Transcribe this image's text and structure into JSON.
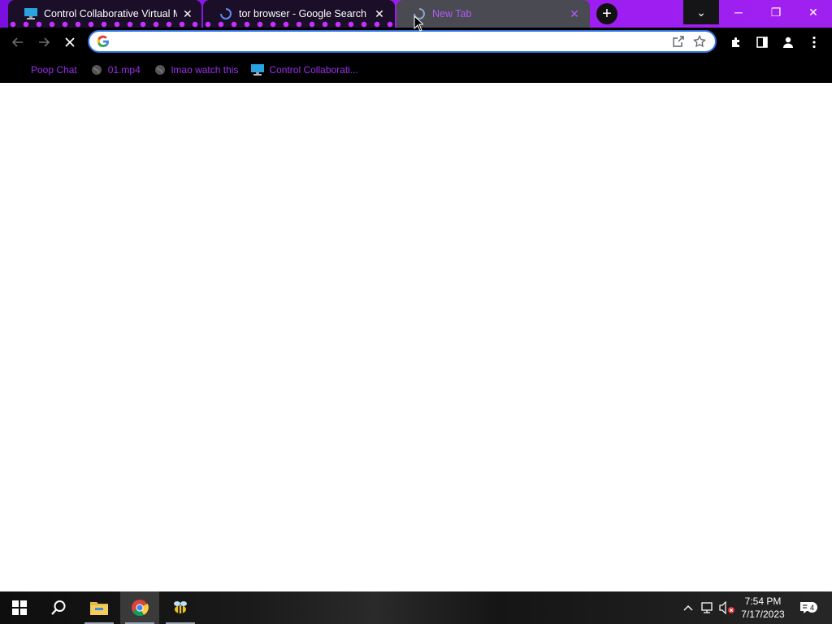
{
  "browser": {
    "tabs": [
      {
        "title": "Control Collaborative Virtual Machine",
        "icon": "monitor-icon",
        "close": "✕"
      },
      {
        "title": "tor browser - Google Search",
        "icon": "loading-spinner-icon",
        "close": "✕"
      },
      {
        "title": "New Tab",
        "icon": "loading-spinner-icon",
        "close": "✕",
        "active": true
      }
    ],
    "new_tab": "+",
    "window_controls": {
      "tab_search": "⌄",
      "minimize": "─",
      "restore": "❐",
      "close": "✕"
    },
    "omnibox": {
      "value": "",
      "placeholder": ""
    },
    "bookmarks": [
      {
        "label": "Poop Chat",
        "icon": "none"
      },
      {
        "label": "01.mp4",
        "icon": "globe-icon"
      },
      {
        "label": "lmao watch this",
        "icon": "globe-icon"
      },
      {
        "label": "Control Collaborati...",
        "icon": "monitor-icon"
      }
    ]
  },
  "taskbar": {
    "clock_time": "7:54 PM",
    "clock_date": "7/17/2023",
    "notification_count": "4"
  },
  "colors": {
    "tab_strip": "#9b1cf2",
    "bookmark_text": "#9b2ff0",
    "omnibox_focus": "#2f6fdf"
  }
}
